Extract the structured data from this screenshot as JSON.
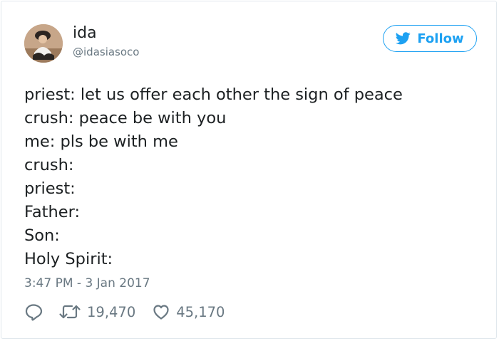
{
  "user": {
    "display_name": "ida",
    "handle": "@idasiasoco"
  },
  "follow_button": {
    "label": "Follow",
    "icon": "twitter-bird-icon"
  },
  "tweet": {
    "lines": [
      "priest: let us offer each other the sign of peace",
      "crush: peace be with you",
      "me: pls be with me",
      "crush:",
      "priest:",
      "Father:",
      "Son:",
      "Holy Spirit:"
    ],
    "timestamp": "3:47 PM - 3 Jan 2017"
  },
  "actions": {
    "reply_icon": "reply-icon",
    "retweet_icon": "retweet-icon",
    "retweet_count": "19,470",
    "like_icon": "heart-icon",
    "like_count": "45,170"
  },
  "colors": {
    "brand": "#1da1f2",
    "text": "#1c2022",
    "muted": "#697882",
    "border": "#e1e8ed"
  }
}
